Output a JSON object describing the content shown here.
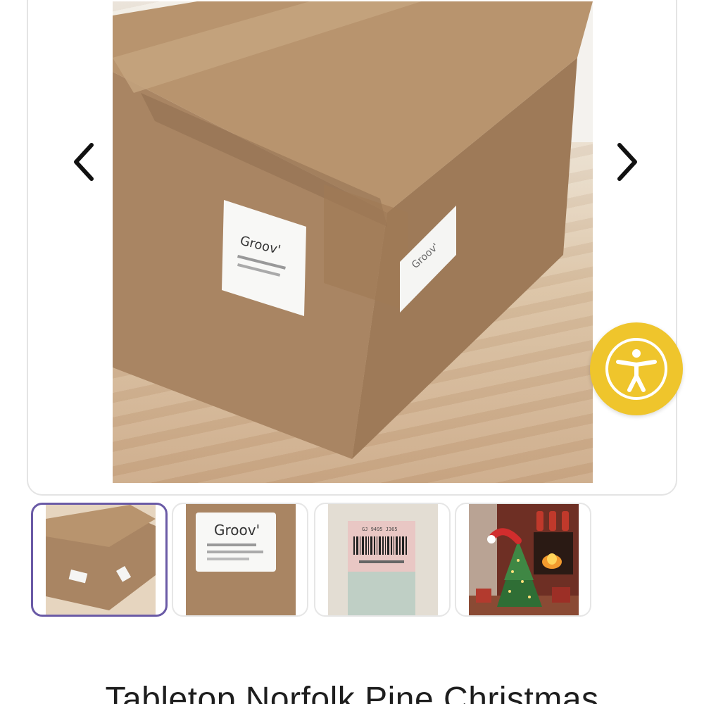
{
  "gallery": {
    "main_image": {
      "alt": "cardboard shipping box",
      "label_brand": "Groov'",
      "label_brand_side": "Groov'"
    },
    "prev_icon": "chevron-left-icon",
    "next_icon": "chevron-right-icon",
    "thumbnails": [
      {
        "name": "thumb-box-closed",
        "selected": true
      },
      {
        "name": "thumb-box-label",
        "label_brand": "Groov'",
        "selected": false
      },
      {
        "name": "thumb-barcode-label",
        "barcode_text": "GJ 9495 J365",
        "selected": false
      },
      {
        "name": "thumb-christmas-tree",
        "selected": false
      }
    ]
  },
  "accessibility": {
    "icon": "accessibility-person-icon"
  },
  "product": {
    "title": "Tabletop Norfolk Pine Christmas"
  },
  "colors": {
    "accent_selected": "#6a5aa6",
    "accessibility_bg": "#efc52c",
    "cardboard": "#b08c68",
    "label_white": "#f8f8f6"
  }
}
